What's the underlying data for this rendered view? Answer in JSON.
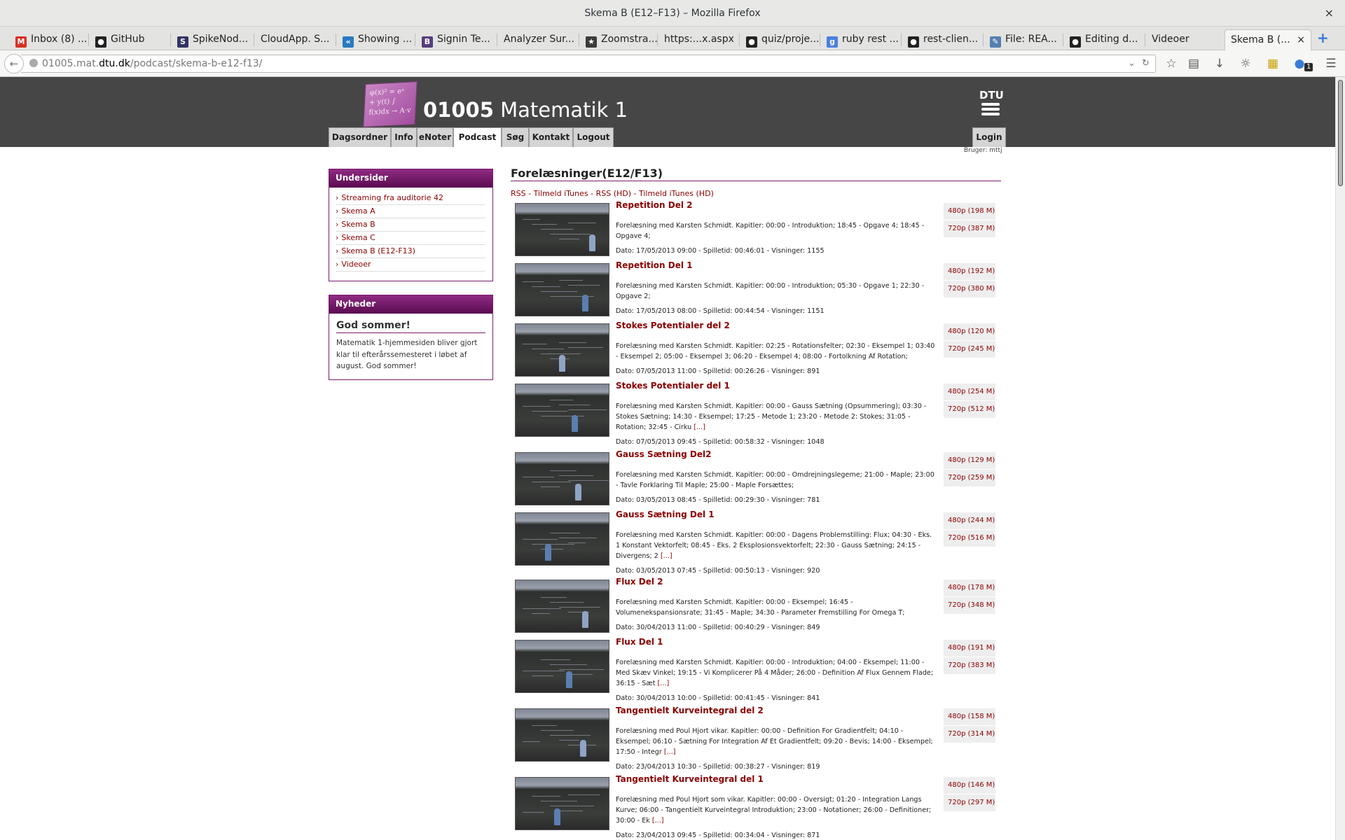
{
  "window": {
    "title": "Skema B (E12–F13) – Mozilla Firefox",
    "close": "×"
  },
  "tabs": [
    {
      "label": "Inbox (8) ...",
      "icon": "gmail-icon",
      "color": "#d93025",
      "glyph": "M"
    },
    {
      "label": "GitHub",
      "icon": "github-icon",
      "color": "#222222",
      "glyph": "●"
    },
    {
      "label": "SpikeNod...",
      "icon": "spikenode-icon",
      "color": "#333366",
      "glyph": "S"
    },
    {
      "label": "CloudApp. S...",
      "icon": "",
      "color": "",
      "glyph": ""
    },
    {
      "label": "Showing ...",
      "icon": "showing-icon",
      "color": "#2a79c1",
      "glyph": "«"
    },
    {
      "label": "Signin Te...",
      "icon": "bootstrap-icon",
      "color": "#563d7c",
      "glyph": "B"
    },
    {
      "label": "Analyzer Sur...",
      "icon": "",
      "color": "",
      "glyph": ""
    },
    {
      "label": "Zoomstra...",
      "icon": "zoomstra-icon",
      "color": "#3b3b3b",
      "glyph": "★"
    },
    {
      "label": "https:...x.aspx",
      "icon": "",
      "color": "",
      "glyph": ""
    },
    {
      "label": "quiz/proje...",
      "icon": "github-icon",
      "color": "#222222",
      "glyph": "●"
    },
    {
      "label": "ruby rest ...",
      "icon": "google-icon",
      "color": "#4a7fe0",
      "glyph": "g"
    },
    {
      "label": "rest-clien...",
      "icon": "github-icon",
      "color": "#222222",
      "glyph": "●"
    },
    {
      "label": "File: REA...",
      "icon": "file-icon",
      "color": "#5580b0",
      "glyph": "✎"
    },
    {
      "label": "Editing d...",
      "icon": "github-icon",
      "color": "#222222",
      "glyph": "●"
    },
    {
      "label": "Videoer",
      "icon": "",
      "color": "",
      "glyph": ""
    },
    {
      "label": "Skema B (...",
      "icon": "",
      "color": "",
      "glyph": "",
      "active": true
    }
  ],
  "urlbar": {
    "prefix": "01005.mat.",
    "domain": "dtu.dk",
    "path": "/podcast/skema-b-e12-f13/"
  },
  "site": {
    "code": "01005",
    "name": "Matematik 1",
    "logo_text": "DTU",
    "logo_formula": "φ(x)² = eˣ + y(t) ∫ f(x)dx → A·v"
  },
  "menu": [
    "Dagsordner",
    "Info",
    "eNoter",
    "Podcast",
    "Søg",
    "Kontakt",
    "Logout"
  ],
  "login": "Login",
  "user_label": "Bruger: mttj",
  "undersider": {
    "heading": "Undersider",
    "items": [
      "Streaming fra auditorie 42",
      "Skema A",
      "Skema B",
      "Skema C",
      "Skema B (E12-F13)",
      "Videoer"
    ]
  },
  "nyheder": {
    "heading": "Nyheder",
    "title": "God sommer!",
    "text": "Matematik 1-hjemmesiden bliver gjort klar til efterårssemesteret i løbet af august. God sommer!"
  },
  "main": {
    "heading": "Forelæsninger(E12/F13)",
    "feed_links": "RSS - Tilmeld iTunes - RSS (HD) - Tilmeld iTunes (HD)"
  },
  "lectures": [
    {
      "title": "Repetition Del 2",
      "desc": "Forelæsning med Karsten Schmidt. Kapitler: 00:00 - Introduktion; 18:45 - Opgave 4; 18:45 - Opgave 4;",
      "more": "",
      "date": "Dato: 17/05/2013 09:00 - Spilletid: 00:46:01 - Visninger: 1155",
      "dl480": "480p (198 M)",
      "dl720": "720p (387 M)"
    },
    {
      "title": "Repetition Del 1",
      "desc": "Forelæsning med Karsten Schmidt. Kapitler: 00:00 - Introduktion; 05:30 - Opgave 1; 22:30 - Opgave 2;",
      "more": "",
      "date": "Dato: 17/05/2013 08:00 - Spilletid: 00:44:54 - Visninger: 1151",
      "dl480": "480p (192 M)",
      "dl720": "720p (380 M)"
    },
    {
      "title": "Stokes Potentialer del 2",
      "desc": "Forelæsning med Karsten Schmidt. Kapitler: 02:25 - Rotationsfelter; 02:30 - Eksempel 1; 03:40 - Eksempel 2; 05:00 - Eksempel 3; 06:20 - Eksempel 4; 08:00 - Fortolkning Af Rotation;",
      "more": "",
      "date": "Dato: 07/05/2013 11:00 - Spilletid: 00:26:26 - Visninger: 891",
      "dl480": "480p (120 M)",
      "dl720": "720p (245 M)"
    },
    {
      "title": "Stokes Potentialer del 1",
      "desc": "Forelæsning med Karsten Schmidt. Kapitler: 00:00 - Gauss Sætning (Opsummering); 03:30 - Stokes Sætning; 14:30 - Eksempel; 17:25 - Metode 1; 23:20 - Metode 2: Stokes; 31:05 - Rotation; 32:45 - Cirku",
      "more": "[...]",
      "date": "Dato: 07/05/2013 09:45 - Spilletid: 00:58:32 - Visninger: 1048",
      "dl480": "480p (254 M)",
      "dl720": "720p (512 M)"
    },
    {
      "title": "Gauss Sætning Del2",
      "desc": "Forelæsning med Karsten Schmidt. Kapitler: 00:00 - Omdrejningslegeme; 21:00 - Maple; 23:00 - Tavle Forklaring Til Maple; 25:00 - Maple Forsættes;",
      "more": "",
      "date": "Dato: 03/05/2013 08:45 - Spilletid: 00:29:30 - Visninger: 781",
      "dl480": "480p (129 M)",
      "dl720": "720p (259 M)"
    },
    {
      "title": "Gauss Sætning Del 1",
      "desc": "Forelæsning med Karsten Schmidt. Kapitler: 00:00 - Dagens Problemstilling: Flux; 04:30 - Eks. 1 Konstant Vektorfelt; 08:45 - Eks. 2 Eksplosionsvektorfelt; 22:30 - Gauss Sætning; 24:15 - Divergens; 2",
      "more": "[...]",
      "date": "Dato: 03/05/2013 07:45 - Spilletid: 00:50:13 - Visninger: 920",
      "dl480": "480p (244 M)",
      "dl720": "720p (516 M)"
    },
    {
      "title": "Flux Del 2",
      "desc": "Forelæsning med Karsten Schmidt. Kapitler: 00:00 - Eksempel; 16:45 - Volumenekspansionsrate; 31:45 - Maple; 34:30 - Parameter Fremstilling For Omega T;",
      "more": "",
      "date": "Dato: 30/04/2013 11:00 - Spilletid: 00:40:29 - Visninger: 849",
      "dl480": "480p (178 M)",
      "dl720": "720p (348 M)"
    },
    {
      "title": "Flux Del 1",
      "desc": "Forelæsning med Karsten Schmidt. Kapitler: 00:00 - Introduktion; 04:00 - Eksempel; 11:00 - Med Skæv Vinkel; 19:15 - Vi Komplicerer På 4 Måder; 26:00 - Definition Af Flux Gennem Flade; 36:15 - Sæt",
      "more": "[...]",
      "date": "Dato: 30/04/2013 10:00 - Spilletid: 00:41:45 - Visninger: 841",
      "dl480": "480p (191 M)",
      "dl720": "720p (383 M)"
    },
    {
      "title": "Tangentielt Kurveintegral del 2",
      "desc": "Forelæsning med Poul Hjort vikar. Kapitler: 00:00 - Definition For Gradientfelt; 04:10 - Eksempel; 06:10 - Sætning For Integration Af Et Gradientfelt; 09:20 - Bevis; 14:00 - Eksempel; 17:50 - Integr",
      "more": "[...]",
      "date": "Dato: 23/04/2013 10:30 - Spilletid: 00:38:27 - Visninger: 819",
      "dl480": "480p (158 M)",
      "dl720": "720p (314 M)"
    },
    {
      "title": "Tangentielt Kurveintegral del 1",
      "desc": "Forelæsning med Poul Hjort som vikar. Kapitler: 00:00 - Oversigt; 01:20 - Integration Langs Kurve; 06:00 - Tangentielt Kurveintegral Introduktion; 23:00 - Notationer; 26:00 - Definitioner; 30:00 - Ek",
      "more": "[...]",
      "date": "Dato: 23/04/2013 09:45 - Spilletid: 00:34:04 - Visninger: 871",
      "dl480": "480p (146 M)",
      "dl720": "720p (297 M)"
    }
  ],
  "colors": {
    "accent": "#8b0000",
    "header": "#464646",
    "box_border": "#7a1d6e"
  }
}
